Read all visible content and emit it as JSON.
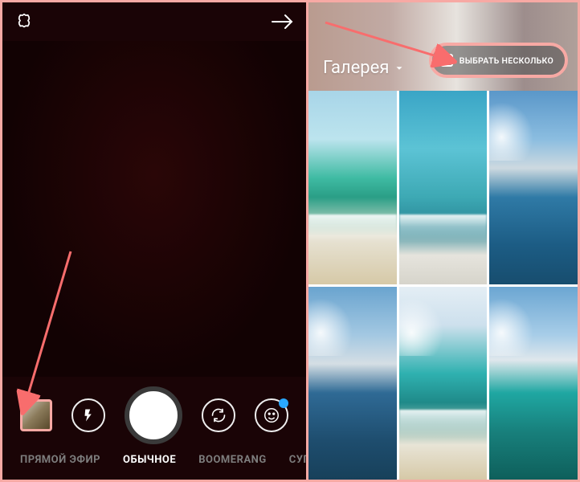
{
  "left": {
    "modes": {
      "live": "ПРЯМОЙ ЭФИР",
      "normal": "ОБЫЧНОЕ",
      "boomerang": "BOOMERANG",
      "superzoom": "СУПЕ"
    }
  },
  "right": {
    "title": "Галерея",
    "selectMultiple": "ВЫБРАТЬ НЕСКОЛЬКО"
  }
}
